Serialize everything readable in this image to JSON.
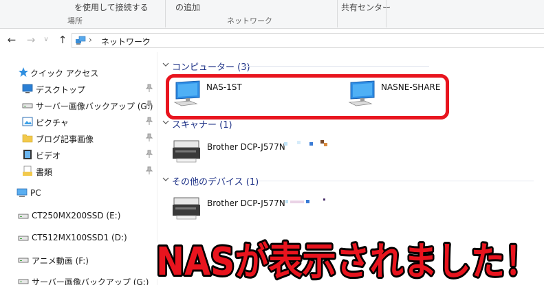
{
  "ribbon": {
    "cmd_connect": "を使用して接続する",
    "cmd_add": "の追加",
    "cmd_share": "共有センター",
    "group_location": "場所",
    "group_network": "ネットワーク"
  },
  "address": {
    "crumb": "ネットワーク"
  },
  "sidebar": {
    "quick_access": "クイック アクセス",
    "items": [
      {
        "label": "デスクトップ",
        "icon": "desktop-icon"
      },
      {
        "label": "サーバー画像バックアップ (G:)",
        "icon": "drive-icon"
      },
      {
        "label": "ピクチャ",
        "icon": "pictures-icon"
      },
      {
        "label": "ブログ記事画像",
        "icon": "folder-icon"
      },
      {
        "label": "ビデオ",
        "icon": "videos-icon"
      },
      {
        "label": "書類",
        "icon": "documents-icon"
      }
    ],
    "pc": "PC",
    "drives": [
      {
        "label": "CT250MX200SSD (E:)"
      },
      {
        "label": "CT512MX100SSD1 (D:)"
      },
      {
        "label": "アニメ動画 (F:)"
      },
      {
        "label": "サーバー画像バックアップ (G:)"
      }
    ]
  },
  "groups": {
    "computers": {
      "title": "コンピューター (3)",
      "items": [
        {
          "label": "NAS-1ST"
        },
        {
          "label": "NASNE-SHARE"
        }
      ]
    },
    "scanners": {
      "title": "スキャナー (1)",
      "items": [
        {
          "label": "Brother DCP-J577N"
        }
      ]
    },
    "other_devices": {
      "title": "その他のデバイス (1)",
      "items": [
        {
          "label": "Brother DCP-J577N"
        }
      ]
    }
  },
  "banner": {
    "text": "NASが表示されました！"
  },
  "colors": {
    "highlight": "#e8141e",
    "banner_fill": "#e8141e",
    "banner_stroke": "#000000",
    "group_header": "#1e3287"
  }
}
